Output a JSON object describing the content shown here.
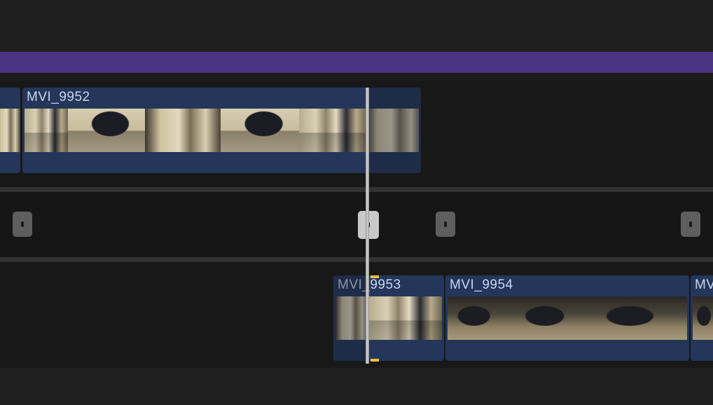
{
  "timeline": {
    "clips": [
      {
        "id": "clip-prev",
        "title": ""
      },
      {
        "id": "clip-9952",
        "title": "MVI_9952"
      },
      {
        "id": "clip-9953",
        "title": "MVI_9953"
      },
      {
        "id": "clip-9954",
        "title": "MVI_9954"
      },
      {
        "id": "clip-next",
        "title": "MV"
      }
    ],
    "colors": {
      "purple_bar": "#4b3583",
      "clip_bg": "#243659",
      "clip_text": "#c9d6ee",
      "playhead_marker": "#e5c33a"
    }
  }
}
